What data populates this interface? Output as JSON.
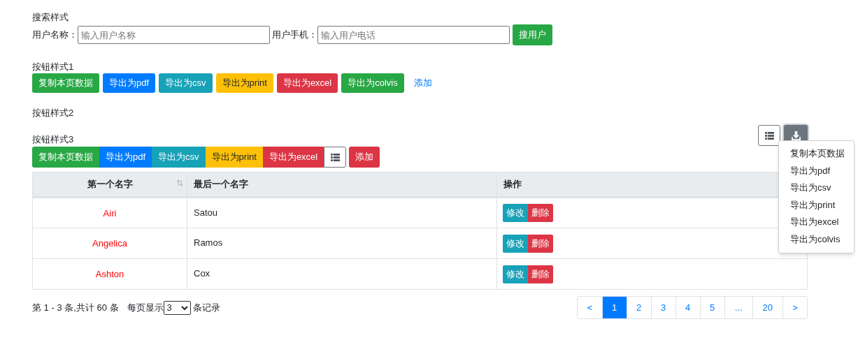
{
  "search": {
    "title": "搜索样式",
    "fields": [
      {
        "label": "用户名称：",
        "placeholder": "输入用户名称"
      },
      {
        "label": "用户手机：",
        "placeholder": "输入用户电话"
      }
    ],
    "button": "搜用户"
  },
  "style1": {
    "title": "按钮样式1",
    "buttons": [
      {
        "label": "复制本页数据",
        "kind": "copy"
      },
      {
        "label": "导出为pdf",
        "kind": "pdf"
      },
      {
        "label": "导出为csv",
        "kind": "csv"
      },
      {
        "label": "导出为print",
        "kind": "print"
      },
      {
        "label": "导出为excel",
        "kind": "excel"
      },
      {
        "label": "导出为colvis",
        "kind": "colvis"
      },
      {
        "label": "添加",
        "kind": "add"
      }
    ]
  },
  "style2": {
    "title": "按钮样式2",
    "menu": {
      "expanded": true,
      "items": [
        "复制本页数据",
        "导出为pdf",
        "导出为csv",
        "导出为print",
        "导出为excel",
        "导出为colvis"
      ]
    }
  },
  "style3": {
    "title": "按钮样式3",
    "buttons": [
      {
        "label": "复制本页数据",
        "kind": "copy"
      },
      {
        "label": "导出为pdf",
        "kind": "pdf"
      },
      {
        "label": "导出为csv",
        "kind": "csv"
      },
      {
        "label": "导出为print",
        "kind": "print"
      },
      {
        "label": "导出为excel",
        "kind": "excel"
      }
    ],
    "add": "添加"
  },
  "table": {
    "columns": [
      "第一个名字",
      "最后一个名字",
      "操作"
    ],
    "rows": [
      {
        "first": "Airi",
        "last": "Satou",
        "edit": "修改",
        "delete": "删除"
      },
      {
        "first": "Angelica",
        "last": "Ramos",
        "edit": "修改",
        "delete": "删除"
      },
      {
        "first": "Ashton",
        "last": "Cox",
        "edit": "修改",
        "delete": "删除"
      }
    ]
  },
  "footer": {
    "summary": "第 1 - 3 条,共计 60 条",
    "per_page_label": "每页显示",
    "per_page": "3",
    "suffix": "条记录"
  },
  "pagination": [
    {
      "label": "<",
      "selected": false
    },
    {
      "label": "1",
      "selected": true
    },
    {
      "label": "2",
      "selected": false
    },
    {
      "label": "3",
      "selected": false
    },
    {
      "label": "4",
      "selected": false
    },
    {
      "label": "5",
      "selected": false
    },
    {
      "label": "...",
      "selected": false
    },
    {
      "label": "20",
      "selected": false
    },
    {
      "label": ">",
      "selected": false
    }
  ]
}
